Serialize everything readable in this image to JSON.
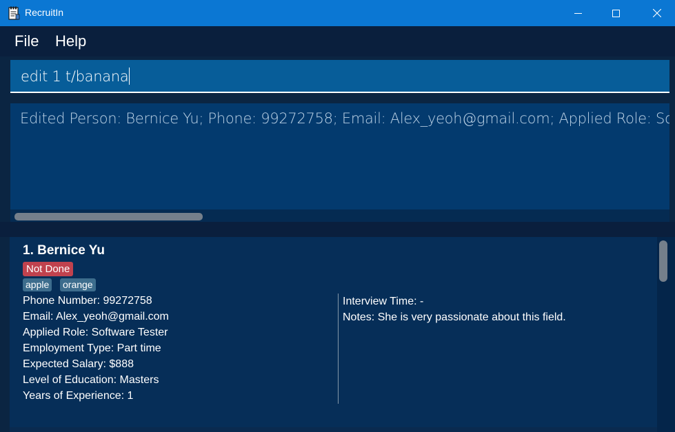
{
  "window": {
    "title": "RecruitIn",
    "icon": "notepad-icon",
    "controls": [
      "minimize",
      "maximize",
      "close"
    ]
  },
  "menu": {
    "items": [
      "File",
      "Help"
    ]
  },
  "command": {
    "value": "edit 1 t/banana"
  },
  "result": {
    "text": "Edited Person: Bernice Yu; Phone: 99272758; Email: Alex_yeoh@gmail.com; Applied Role: Software Tester; Employment Type: Part time; Expected Salary: $888; Level of Education: Masters; Years of Experience: 1; Interview Time: -; Notes: She is very passionate about this field.; Tags: [apple][orange]; Done: Not Done"
  },
  "persons": [
    {
      "index_name": "1.  Bernice Yu",
      "status": "Not Done",
      "status_color": "#c0424e",
      "tags": [
        "apple",
        "orange"
      ],
      "details_left": [
        "Phone Number: 99272758",
        "Email: Alex_yeoh@gmail.com",
        "Applied Role: Software Tester",
        "Employment Type: Part time",
        "Expected Salary: $888",
        "Level of Education: Masters",
        "Years of Experience: 1"
      ],
      "details_right": [
        "Interview Time: -",
        "Notes: She is very passionate about this field."
      ]
    }
  ],
  "colors": {
    "titlebar": "#0b77d3",
    "background": "#0b2542",
    "command_box": "#075d99",
    "result_box": "#033a6e",
    "card": "#062e58",
    "tag": "#3d6d8d"
  }
}
